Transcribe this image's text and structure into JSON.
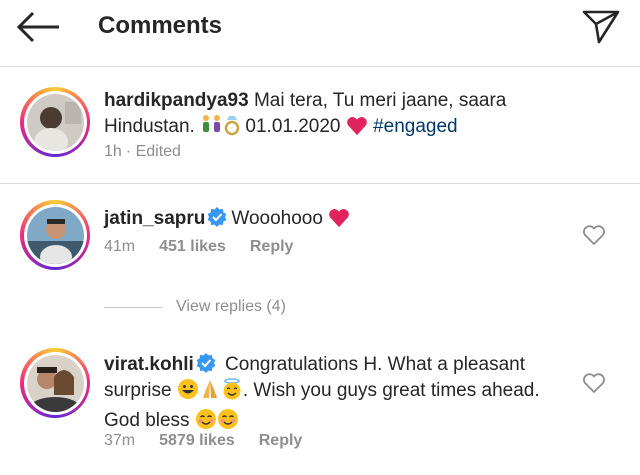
{
  "header": {
    "title": "Comments"
  },
  "caption": {
    "username": "hardikpandya93",
    "text_part1": " Mai tera, Tu meri jaane, saara",
    "text_part2": "Hindustan. ",
    "date": " 01.01.2020 ",
    "hashtag": "#engaged",
    "time": "1h",
    "edited": "· Edited"
  },
  "comments": [
    {
      "username": "jatin_sapru",
      "text": "Wooohooo",
      "time": "41m",
      "likes": "451 likes",
      "reply": "Reply"
    },
    {
      "username": "virat.kohli",
      "text_line1": "Congratulations H. What a pleasant",
      "text_line2a": "surprise ",
      "text_line2b": ". Wish you guys great times ahead.",
      "text_line3": "God bless ",
      "time": "37m",
      "likes": "5879 likes",
      "reply": "Reply"
    }
  ],
  "view_replies": "View replies (4)",
  "colors": {
    "hashtag": "#00376b",
    "heart": "#e0245e",
    "verified": "#3897f0",
    "meta": "#8e8e8e"
  }
}
